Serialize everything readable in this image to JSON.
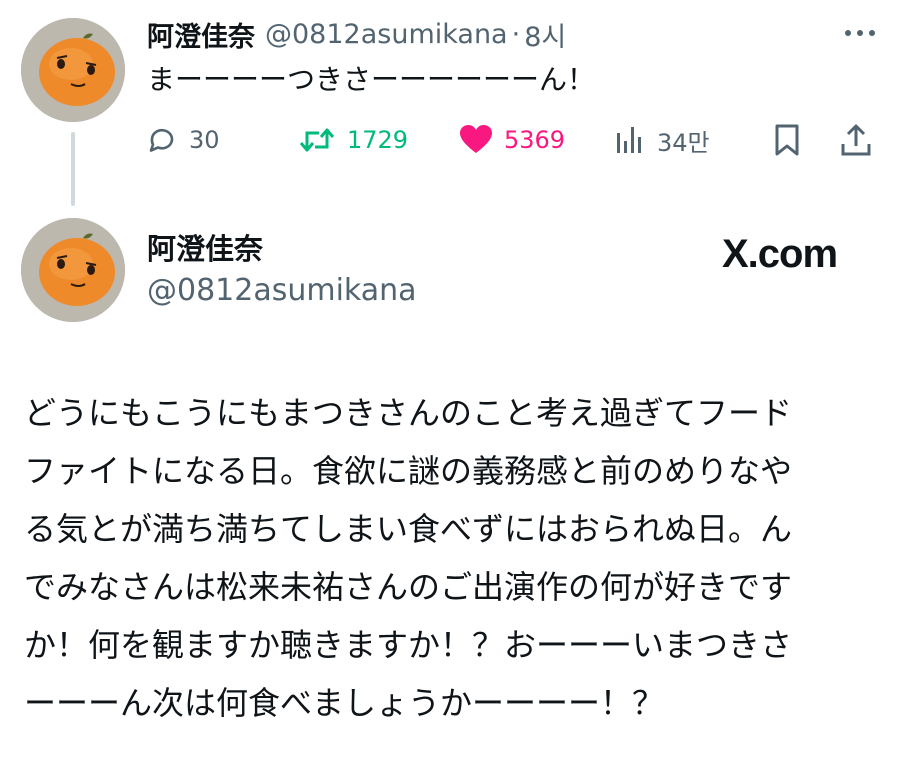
{
  "reply": {
    "display_name": "阿澄佳奈",
    "handle": "@0812asumikana",
    "separator": "·",
    "time": "8시",
    "text": "まーーーーつきさーーーーーーん！",
    "actions": {
      "reply_count": "30",
      "retweet_count": "1729",
      "like_count": "5369",
      "views_count": "34만"
    },
    "icons": [
      "reply-icon",
      "retweet-icon",
      "heart-icon",
      "views-icon",
      "bookmark-icon",
      "share-icon",
      "more-icon"
    ],
    "colors": {
      "retweet": "#00ba7c",
      "like": "#f91880",
      "muted": "#536471"
    }
  },
  "card": {
    "display_name": "阿澄佳奈",
    "handle": "@0812asumikana",
    "site_logo": "X.com",
    "text_lines": [
      "どうにもこうにもまつきさんのこと考え過ぎてフード",
      "ファイトになる日。食欲に謎の義務感と前のめりなや",
      "る気とが満ち満ちてしまい食べずにはおられぬ日。ん",
      "でみなさんは松来未祐さんのご出演作の何が好きです",
      "か！何を観ますか聴きますか！？おーーーいまつきさ",
      "ーーーん次は何食べましょうかーーーー！？"
    ]
  }
}
